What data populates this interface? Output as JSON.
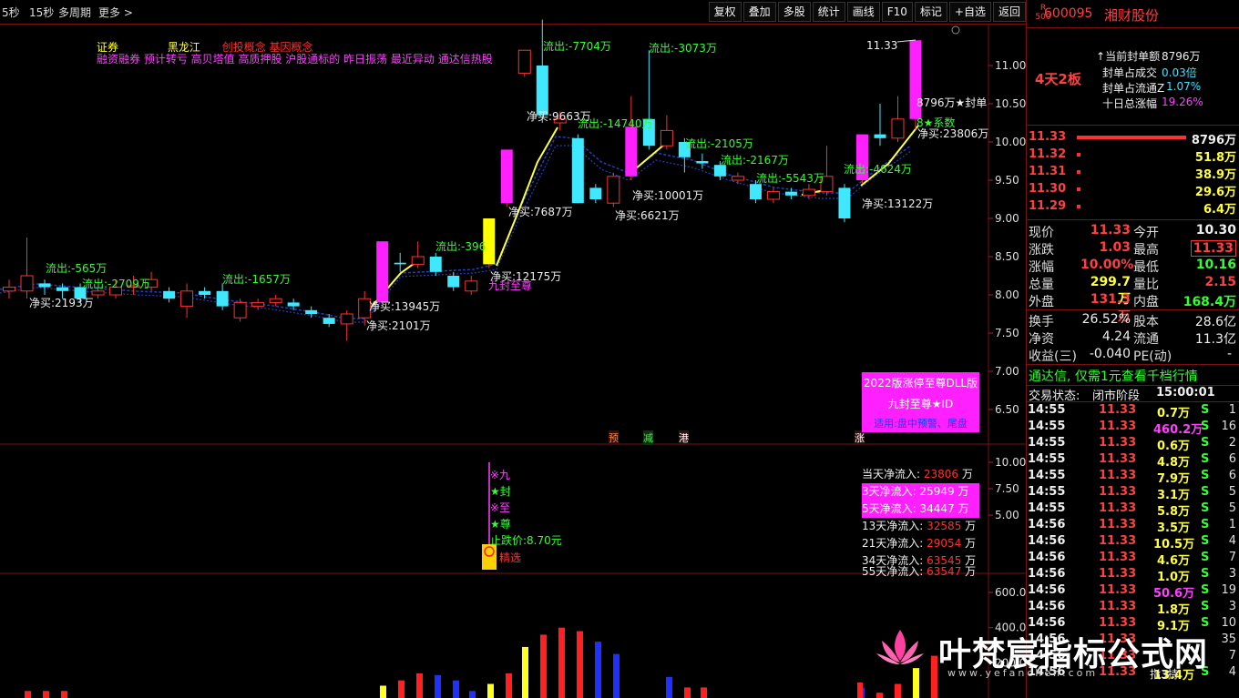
{
  "topbar": {
    "items": [
      "5秒",
      "15秒",
      "多周期",
      "更多 >"
    ],
    "toolbar": [
      "复权",
      "叠加",
      "多股",
      "统计",
      "画线",
      "F10",
      "标记",
      "+自选",
      "返回"
    ]
  },
  "stock": {
    "badge_top": "R",
    "badge_bottom": "500",
    "code": "600095",
    "name": "湘财股份",
    "board": "4天2板"
  },
  "seal_info": [
    {
      "label": "当前封单额",
      "value": "8796万"
    },
    {
      "label": "封单占成交",
      "value": "0.03倍"
    },
    {
      "label": "封单占流通Z",
      "value": "1.07%"
    },
    {
      "label": "十日总涨幅",
      "value": "19.26%"
    }
  ],
  "order_book": [
    {
      "price": "11.33",
      "vol": "8796万"
    },
    {
      "price": "11.32",
      "vol": "51.8万"
    },
    {
      "price": "11.31",
      "vol": "38.9万"
    },
    {
      "price": "11.30",
      "vol": "29.6万"
    },
    {
      "price": "11.29",
      "vol": "6.4万"
    }
  ],
  "quote": {
    "现价": "11.33",
    "今开": "10.30",
    "涨跌": "1.03",
    "最高": "11.33",
    "涨幅": "10.00%",
    "最低": "10.16",
    "总量": "299.7万",
    "量比": "2.15",
    "外盘": "131.3万",
    "内盘": "168.4万",
    "换手": "26.52%",
    "股本": "28.6亿",
    "净资": "4.24",
    "流通": "11.3亿",
    "收益(三)": "-0.040",
    "PE(动)": "-"
  },
  "ad_text": "通达信, 仅需1元查看千档行情",
  "trade_status": {
    "label": "交易状态:",
    "value": "闭市阶段",
    "time": "15:00:01"
  },
  "ticks": [
    {
      "t": "14:55",
      "p": "11.33",
      "v": "0.7万",
      "s": "S",
      "n": "1"
    },
    {
      "t": "14:55",
      "p": "11.33",
      "v": "460.2万",
      "s": "S",
      "n": "16"
    },
    {
      "t": "14:55",
      "p": "11.33",
      "v": "0.6万",
      "s": "S",
      "n": "2"
    },
    {
      "t": "14:55",
      "p": "11.33",
      "v": "4.8万",
      "s": "S",
      "n": "6"
    },
    {
      "t": "14:55",
      "p": "11.33",
      "v": "7.9万",
      "s": "S",
      "n": "6"
    },
    {
      "t": "14:55",
      "p": "11.33",
      "v": "3.1万",
      "s": "S",
      "n": "5"
    },
    {
      "t": "14:55",
      "p": "11.33",
      "v": "5.8万",
      "s": "S",
      "n": "5"
    },
    {
      "t": "14:56",
      "p": "11.33",
      "v": "3.5万",
      "s": "S",
      "n": "1"
    },
    {
      "t": "14:56",
      "p": "11.33",
      "v": "10.5万",
      "s": "S",
      "n": "4"
    },
    {
      "t": "14:56",
      "p": "11.33",
      "v": "4.6万",
      "s": "S",
      "n": "7"
    },
    {
      "t": "14:56",
      "p": "11.33",
      "v": "1.0万",
      "s": "S",
      "n": "3"
    },
    {
      "t": "14:56",
      "p": "11.33",
      "v": "50.6万",
      "s": "S",
      "n": "19"
    },
    {
      "t": "14:56",
      "p": "11.33",
      "v": "1.8万",
      "s": "S",
      "n": "3"
    },
    {
      "t": "14:56",
      "p": "11.33",
      "v": "9.1万",
      "s": "S",
      "n": "10"
    },
    {
      "t": "14:56",
      "p": "11.33",
      "v": "",
      "s": "",
      "n": "35"
    },
    {
      "t": "14:56",
      "p": "11.33",
      "v": "",
      "s": "",
      "n": "7"
    },
    {
      "t": "14:56",
      "p": "11.33",
      "v": "13.4万",
      "s": "S",
      "n": "4"
    }
  ],
  "chart_overlay": {
    "concepts_line1": [
      "证券",
      "黑龙江",
      "创投概念 基因概念"
    ],
    "concepts_line2": "融资融券 预计转亏 高贝塔值 高质押股 沪股通标的 昨日振荡 最近异动 通达信热股",
    "price_axis": [
      "11.00",
      "10.50",
      "10.00",
      "9.50",
      "9.00",
      "8.50",
      "8.00",
      "7.50",
      "7.00",
      "6.50"
    ],
    "mid_axis": [
      "10.00",
      "7.50",
      "5.00"
    ],
    "vol_axis": [
      "600.0",
      "400.0",
      "200.0"
    ],
    "high_label": "11.33",
    "seal_label": "8796万★封单",
    "coef_label": "8★系数",
    "signal_label": "九封至尊",
    "ann": [
      {
        "text": "流出:-565万",
        "c": "g"
      },
      {
        "text": "流出:-2709万",
        "c": "g"
      },
      {
        "text": "流出:-1657万",
        "c": "g"
      },
      {
        "text": "净买:2193万",
        "c": "w"
      },
      {
        "text": "净买:13945万",
        "c": "w"
      },
      {
        "text": "净买:2101万",
        "c": "w"
      },
      {
        "text": "流出:-396",
        "c": "g"
      },
      {
        "text": "净买:12175万",
        "c": "w"
      },
      {
        "text": "净买:7687万",
        "c": "w"
      },
      {
        "text": "净买:9663万",
        "c": "w"
      },
      {
        "text": "流出:-7704万",
        "c": "g"
      },
      {
        "text": "流出:-14740万",
        "c": "g"
      },
      {
        "text": "流出:-3073万",
        "c": "g"
      },
      {
        "text": "净买:10001万",
        "c": "w"
      },
      {
        "text": "净买:6621万",
        "c": "w"
      },
      {
        "text": "流出:-2105万",
        "c": "g"
      },
      {
        "text": "流出:-2167万",
        "c": "g"
      },
      {
        "text": "流出:-5543万",
        "c": "g"
      },
      {
        "text": "流出:-4624万",
        "c": "g"
      },
      {
        "text": "净买:13122万",
        "c": "w"
      },
      {
        "text": "净买:23806万",
        "c": "w"
      }
    ],
    "markers": [
      "预",
      "减",
      "港",
      "涨"
    ],
    "promo_box": {
      "title": "2022版涨停至尊DLL版",
      "name": "九封至尊★ID",
      "foot": "适用:盘中预警、尾盘"
    },
    "signals": [
      "※九",
      "★封",
      "※至",
      "★尊",
      "止跌价:8.70元",
      "精选"
    ],
    "flows": [
      {
        "label": "当天净流入:",
        "value": "23806",
        "unit": "万",
        "hl": false
      },
      {
        "label": "3天净流入:",
        "value": "25949",
        "unit": "万",
        "hl": true
      },
      {
        "label": "5天净流入:",
        "value": "34447",
        "unit": "万",
        "hl": true
      },
      {
        "label": "13天净流入:",
        "value": "32585",
        "unit": "万",
        "hl": false
      },
      {
        "label": "21天净流入:",
        "value": "29054",
        "unit": "万",
        "hl": false
      },
      {
        "label": "34天净流入:",
        "value": "63545",
        "unit": "万",
        "hl": false
      },
      {
        "label": "55天净流入:",
        "value": "63547",
        "unit": "万",
        "hl": false
      }
    ],
    "watermark": {
      "title": "叶梵宸指标公式网",
      "url": "www.yefanchen.com"
    },
    "buy_mark": "指3持"
  },
  "chart_data": {
    "type": "candlestick",
    "candles": [
      {
        "o": 8.05,
        "c": 8.1,
        "h": 8.2,
        "l": 7.95,
        "u": true
      },
      {
        "o": 8.05,
        "c": 8.25,
        "h": 8.75,
        "l": 7.95,
        "u": true
      },
      {
        "o": 8.15,
        "c": 8.1,
        "h": 8.2,
        "l": 8.0,
        "u": false
      },
      {
        "o": 8.1,
        "c": 8.05,
        "h": 8.15,
        "l": 7.95,
        "u": false
      },
      {
        "o": 8.1,
        "c": 7.95,
        "h": 8.15,
        "l": 7.9,
        "u": false
      },
      {
        "o": 8.0,
        "c": 8.05,
        "h": 8.1,
        "l": 7.95,
        "u": true
      },
      {
        "o": 8.0,
        "c": 8.1,
        "h": 8.2,
        "l": 7.95,
        "u": true
      },
      {
        "o": 8.1,
        "c": 8.12,
        "h": 8.25,
        "l": 8.0,
        "u": true
      },
      {
        "o": 8.1,
        "c": 8.2,
        "h": 8.3,
        "l": 8.05,
        "u": true
      },
      {
        "o": 8.05,
        "c": 7.95,
        "h": 8.1,
        "l": 7.9,
        "u": false
      },
      {
        "o": 7.85,
        "c": 8.05,
        "h": 8.15,
        "l": 7.7,
        "u": true
      },
      {
        "o": 8.05,
        "c": 8.0,
        "h": 8.1,
        "l": 7.95,
        "u": false
      },
      {
        "o": 8.05,
        "c": 7.85,
        "h": 8.15,
        "l": 7.8,
        "u": false
      },
      {
        "o": 7.7,
        "c": 7.9,
        "h": 7.95,
        "l": 7.65,
        "u": true
      },
      {
        "o": 7.85,
        "c": 7.9,
        "h": 7.95,
        "l": 7.8,
        "u": true
      },
      {
        "o": 7.9,
        "c": 7.95,
        "h": 8.0,
        "l": 7.85,
        "u": true
      },
      {
        "o": 7.9,
        "c": 7.85,
        "h": 7.95,
        "l": 7.8,
        "u": false
      },
      {
        "o": 7.8,
        "c": 7.75,
        "h": 7.85,
        "l": 7.7,
        "u": false
      },
      {
        "o": 7.7,
        "c": 7.62,
        "h": 7.75,
        "l": 7.58,
        "u": false
      },
      {
        "o": 7.62,
        "c": 7.75,
        "h": 7.8,
        "l": 7.4,
        "u": true
      },
      {
        "o": 7.7,
        "c": 7.95,
        "h": 8.05,
        "l": 7.6,
        "u": true
      },
      {
        "o": 7.9,
        "c": 8.7,
        "h": 8.7,
        "l": 7.85,
        "u": true
      },
      {
        "o": 8.4,
        "c": 8.42,
        "h": 8.55,
        "l": 8.3,
        "u": false
      },
      {
        "o": 8.4,
        "c": 8.5,
        "h": 8.7,
        "l": 8.35,
        "u": true
      },
      {
        "o": 8.5,
        "c": 8.3,
        "h": 8.55,
        "l": 8.25,
        "u": false
      },
      {
        "o": 8.25,
        "c": 8.1,
        "h": 8.3,
        "l": 8.05,
        "u": false
      },
      {
        "o": 8.05,
        "c": 8.18,
        "h": 8.25,
        "l": 8.0,
        "u": true
      },
      {
        "o": 8.4,
        "c": 9.0,
        "h": 9.0,
        "l": 8.35,
        "u": true
      },
      {
        "o": 9.2,
        "c": 9.9,
        "h": 9.9,
        "l": 9.15,
        "u": true
      },
      {
        "o": 10.9,
        "c": 11.2,
        "h": 11.2,
        "l": 10.85,
        "u": true
      },
      {
        "o": 11.0,
        "c": 10.35,
        "h": 11.6,
        "l": 10.25,
        "u": false
      },
      {
        "o": 10.25,
        "c": 10.3,
        "h": 10.4,
        "l": 10.15,
        "u": true
      },
      {
        "o": 10.05,
        "c": 9.2,
        "h": 10.1,
        "l": 9.2,
        "u": false
      },
      {
        "o": 9.4,
        "c": 9.25,
        "h": 9.45,
        "l": 9.2,
        "u": false
      },
      {
        "o": 9.2,
        "c": 9.55,
        "h": 9.6,
        "l": 9.15,
        "u": true
      },
      {
        "o": 9.55,
        "c": 10.2,
        "h": 10.6,
        "l": 9.5,
        "u": true
      },
      {
        "o": 10.3,
        "c": 9.95,
        "h": 11.2,
        "l": 9.9,
        "u": false
      },
      {
        "o": 9.95,
        "c": 10.15,
        "h": 10.35,
        "l": 9.9,
        "u": true
      },
      {
        "o": 10.0,
        "c": 9.8,
        "h": 10.05,
        "l": 9.6,
        "u": false
      },
      {
        "o": 9.75,
        "c": 9.72,
        "h": 9.85,
        "l": 9.65,
        "u": false
      },
      {
        "o": 9.7,
        "c": 9.55,
        "h": 9.75,
        "l": 9.5,
        "u": false
      },
      {
        "o": 9.5,
        "c": 9.55,
        "h": 9.6,
        "l": 9.45,
        "u": true
      },
      {
        "o": 9.45,
        "c": 9.25,
        "h": 9.5,
        "l": 9.2,
        "u": false
      },
      {
        "o": 9.25,
        "c": 9.35,
        "h": 9.4,
        "l": 9.2,
        "u": true
      },
      {
        "o": 9.3,
        "c": 9.35,
        "h": 9.4,
        "l": 9.25,
        "u": false
      },
      {
        "o": 9.3,
        "c": 9.38,
        "h": 9.45,
        "l": 9.25,
        "u": true
      },
      {
        "o": 9.35,
        "c": 9.55,
        "h": 9.95,
        "l": 9.3,
        "u": true
      },
      {
        "o": 9.4,
        "c": 9.0,
        "h": 9.45,
        "l": 8.95,
        "u": false
      },
      {
        "o": 9.5,
        "c": 10.1,
        "h": 10.1,
        "l": 9.45,
        "u": true
      },
      {
        "o": 10.1,
        "c": 10.05,
        "h": 10.5,
        "l": 9.95,
        "u": false
      },
      {
        "o": 10.05,
        "c": 10.3,
        "h": 10.6,
        "l": 10.0,
        "u": true
      },
      {
        "o": 10.3,
        "c": 11.33,
        "h": 11.33,
        "l": 10.16,
        "u": true
      }
    ],
    "volume": [
      {
        "v": 40,
        "c": "r"
      },
      {
        "v": 40,
        "c": "r"
      },
      {
        "v": 40,
        "c": "r"
      },
      {
        "v": 70,
        "c": "y"
      },
      {
        "v": 100,
        "c": "r"
      },
      {
        "v": 140,
        "c": "r"
      },
      {
        "v": 130,
        "c": "b"
      },
      {
        "v": 100,
        "c": "b"
      },
      {
        "v": 40,
        "c": "b"
      },
      {
        "v": 80,
        "c": "y"
      },
      {
        "v": 140,
        "c": "r"
      },
      {
        "v": 290,
        "c": "y"
      },
      {
        "v": 360,
        "c": "r"
      },
      {
        "v": 400,
        "c": "r"
      },
      {
        "v": 380,
        "c": "r"
      },
      {
        "v": 320,
        "c": "b"
      },
      {
        "v": 250,
        "c": "b"
      },
      {
        "v": 120,
        "c": "b"
      },
      {
        "v": 60,
        "c": "r"
      },
      {
        "v": 60,
        "c": "r"
      },
      {
        "v": 60,
        "c": "b"
      },
      {
        "v": 30,
        "c": "r"
      },
      {
        "v": 80,
        "c": "r"
      },
      {
        "v": 170,
        "c": "y"
      },
      {
        "v": 240,
        "c": "r"
      }
    ]
  }
}
